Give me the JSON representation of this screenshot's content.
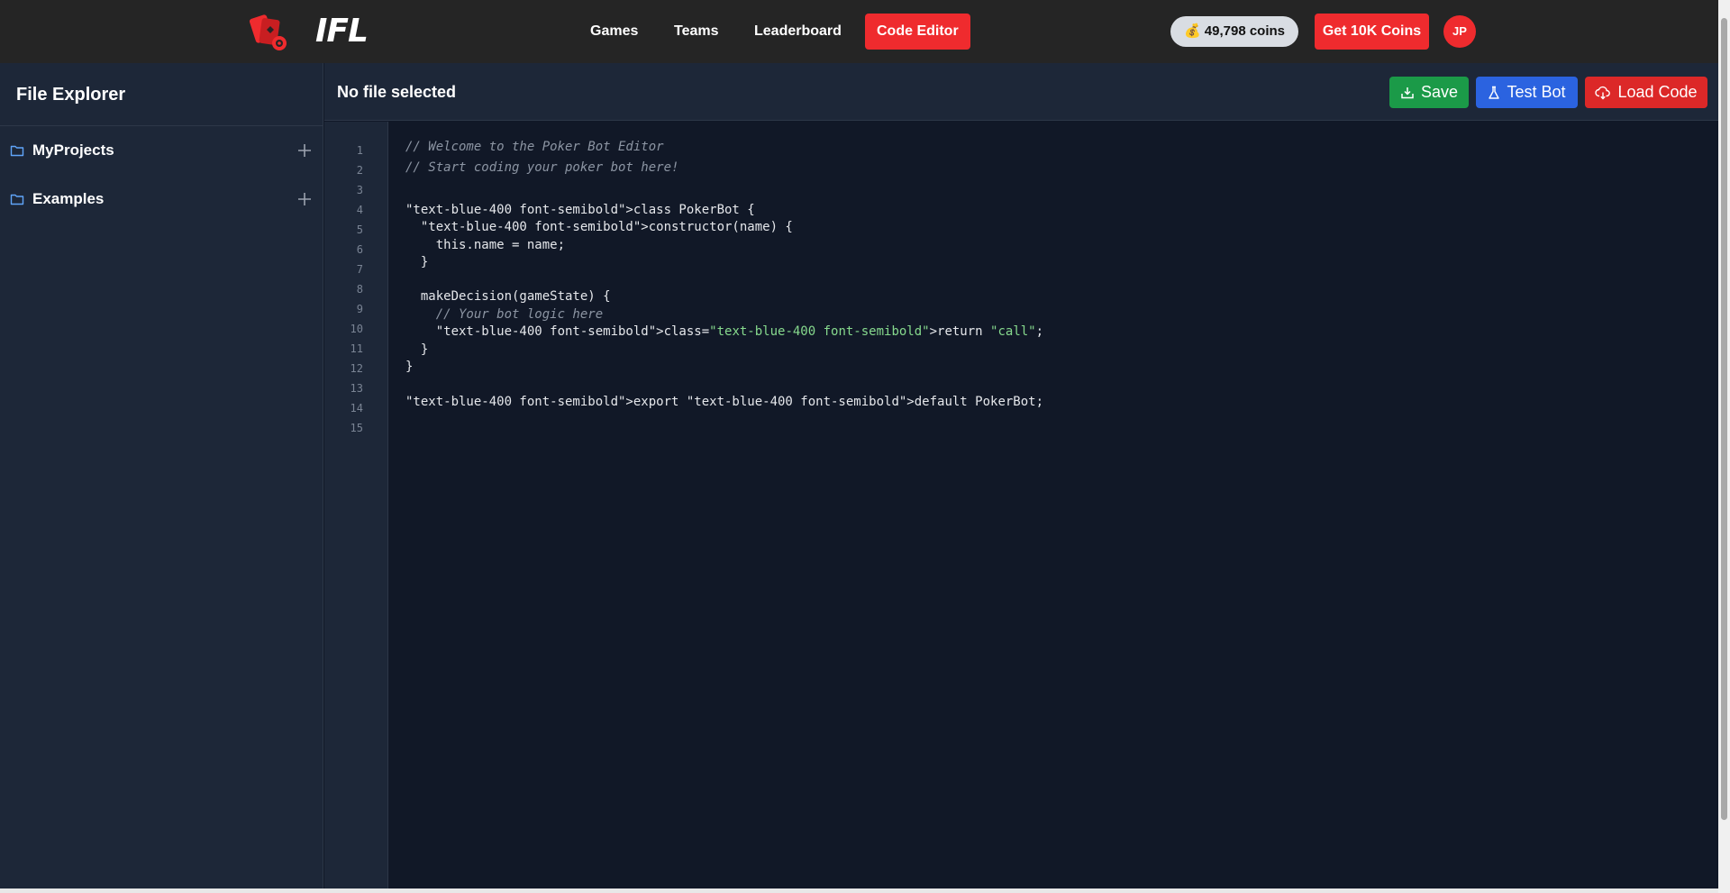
{
  "app": {
    "logo_text": "IFL",
    "nav": [
      "Games",
      "Teams",
      "Leaderboard",
      "Code Editor"
    ],
    "active_nav": "Code Editor",
    "coins": "💰 49,798 coins",
    "get_coins_label": "Get 10K Coins",
    "avatar_initials": "JP",
    "brand_color": "#ef2b2e"
  },
  "sidebar": {
    "title": "File Explorer",
    "folders": [
      {
        "label": "MyProjects"
      },
      {
        "label": "Examples"
      }
    ]
  },
  "editor": {
    "file_title": "No file selected",
    "buttons": {
      "save": "Save",
      "test": "Test Bot",
      "load": "Load Code"
    },
    "line_numbers": [
      "1",
      "2",
      "3",
      "4",
      "5",
      "6",
      "7",
      "8",
      "9",
      "10",
      "11",
      "12",
      "13",
      "14",
      "15"
    ],
    "lines": [
      "// Welcome to the Poker Bot Editor",
      "// Start coding your poker bot here!",
      "",
      "\"text-blue-400 font-semibold\">class PokerBot {",
      "  \"text-blue-400 font-semibold\">constructor(name) {",
      "    this.name = name;",
      "  }",
      "",
      "  makeDecision(gameState) {",
      "    // Your bot logic here",
      "    \"text-blue-400 font-semibold\">class=",
      "\"text-blue-400 font-semibold\"",
      ">return ",
      "\"call\"",
      ";",
      "  }",
      "}",
      "",
      "\"text-blue-400 font-semibold\">export \"text-blue-400 font-semibold\">default PokerBot;",
      ""
    ]
  }
}
